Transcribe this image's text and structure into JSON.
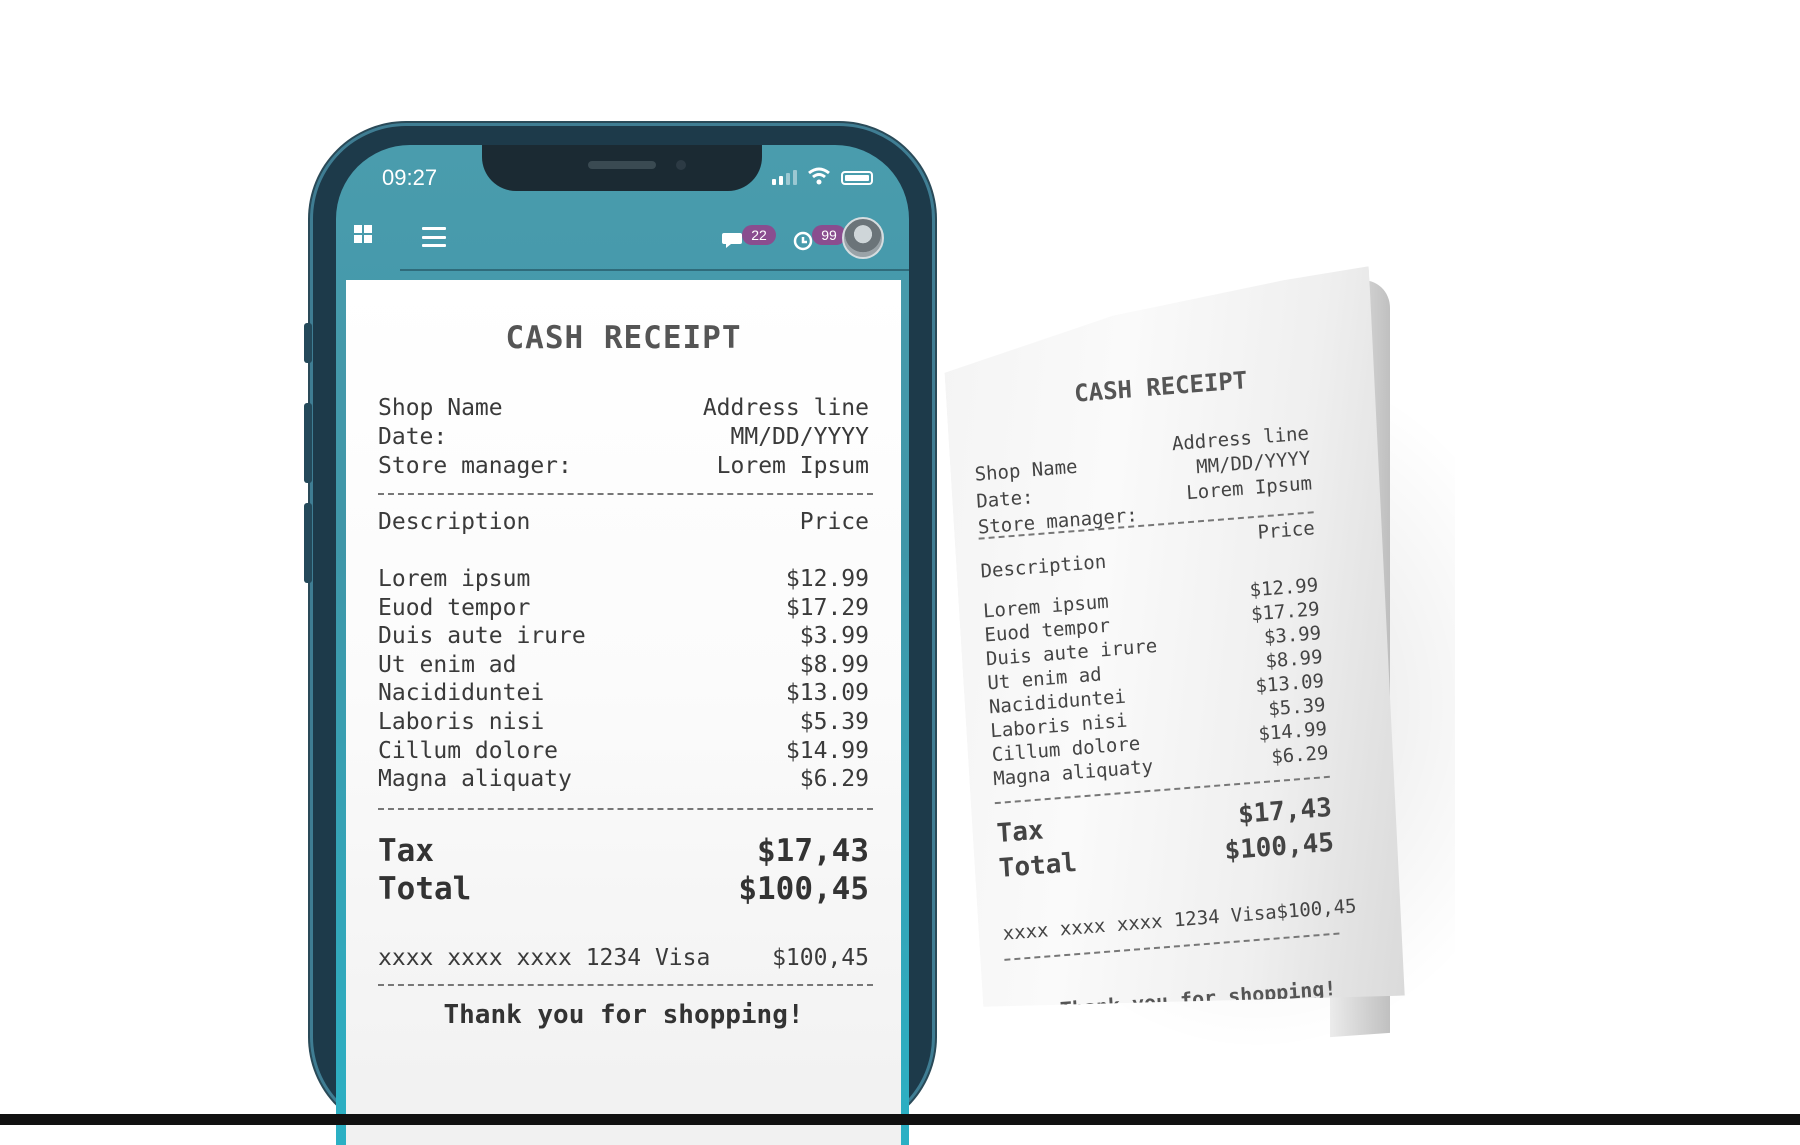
{
  "status": {
    "time": "09:27"
  },
  "topbar": {
    "chat_badge": "22",
    "history_badge": "99"
  },
  "receipt": {
    "title": "CASH RECEIPT",
    "header": [
      {
        "label": "Shop Name",
        "value": "Address line"
      },
      {
        "label": "Date:",
        "value": "MM/DD/YYYY"
      },
      {
        "label": "Store manager:",
        "value": "Lorem Ipsum"
      }
    ],
    "columns": {
      "description": "Description",
      "price": "Price"
    },
    "items": [
      {
        "name": "Lorem ipsum",
        "price": "$12.99"
      },
      {
        "name": "Euod tempor",
        "price": "$17.29"
      },
      {
        "name": "Duis aute irure",
        "price": "$3.99"
      },
      {
        "name": "Ut enim ad",
        "price": "$8.99"
      },
      {
        "name": "Nacididuntei",
        "price": "$13.09"
      },
      {
        "name": "Laboris nisi",
        "price": "$5.39"
      },
      {
        "name": "Cillum dolore",
        "price": "$14.99"
      },
      {
        "name": "Magna aliquaty",
        "price": "$6.29"
      }
    ],
    "tax": {
      "label": "Tax",
      "value": "$17,43"
    },
    "total": {
      "label": "Total",
      "value": "$100,45"
    },
    "payment": {
      "card": "xxxx xxxx xxxx 1234 Visa",
      "amount": "$100,45"
    },
    "thanks": "Thank you for shopping!"
  }
}
